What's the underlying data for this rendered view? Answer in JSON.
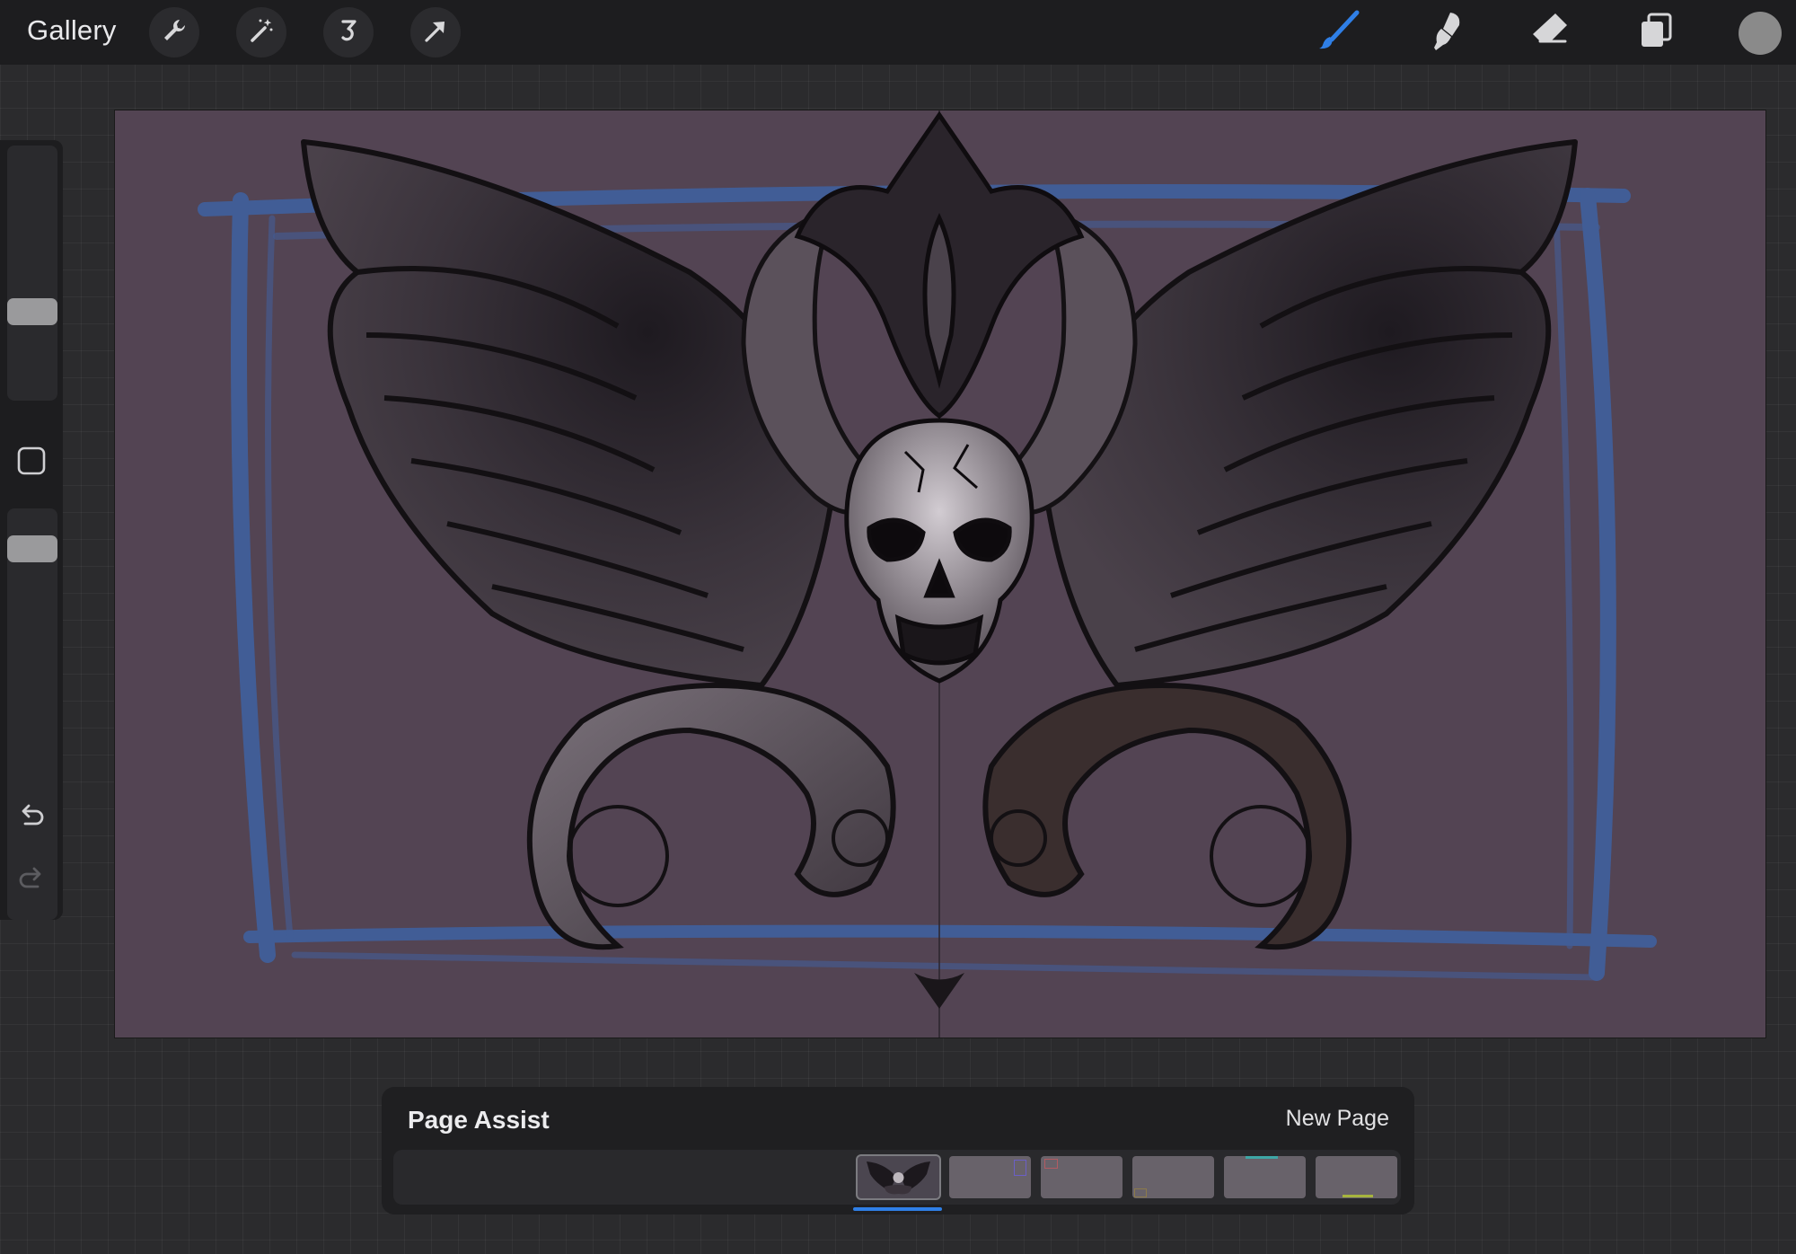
{
  "topbar": {
    "gallery_label": "Gallery",
    "left_tools": [
      {
        "name": "actions-wrench-icon"
      },
      {
        "name": "adjustments-wand-icon"
      },
      {
        "name": "selection-icon"
      },
      {
        "name": "transform-arrow-icon"
      }
    ],
    "right_tools": [
      {
        "name": "brush-icon",
        "active": true
      },
      {
        "name": "smudge-icon"
      },
      {
        "name": "eraser-icon"
      },
      {
        "name": "layers-icon"
      }
    ],
    "current_color": "#8a8a8a",
    "active_tool_color": "#2f7fe6"
  },
  "sidebar": {
    "brush_size_level": 0.33,
    "opacity_level": 0.93
  },
  "canvas": {
    "background": "#534453",
    "artwork": "winged-skull-illustration",
    "sketch_frame_color": "#3f63a3"
  },
  "page_assist": {
    "title": "Page Assist",
    "new_page_label": "New Page",
    "page_count": 6,
    "active_page": 1
  }
}
